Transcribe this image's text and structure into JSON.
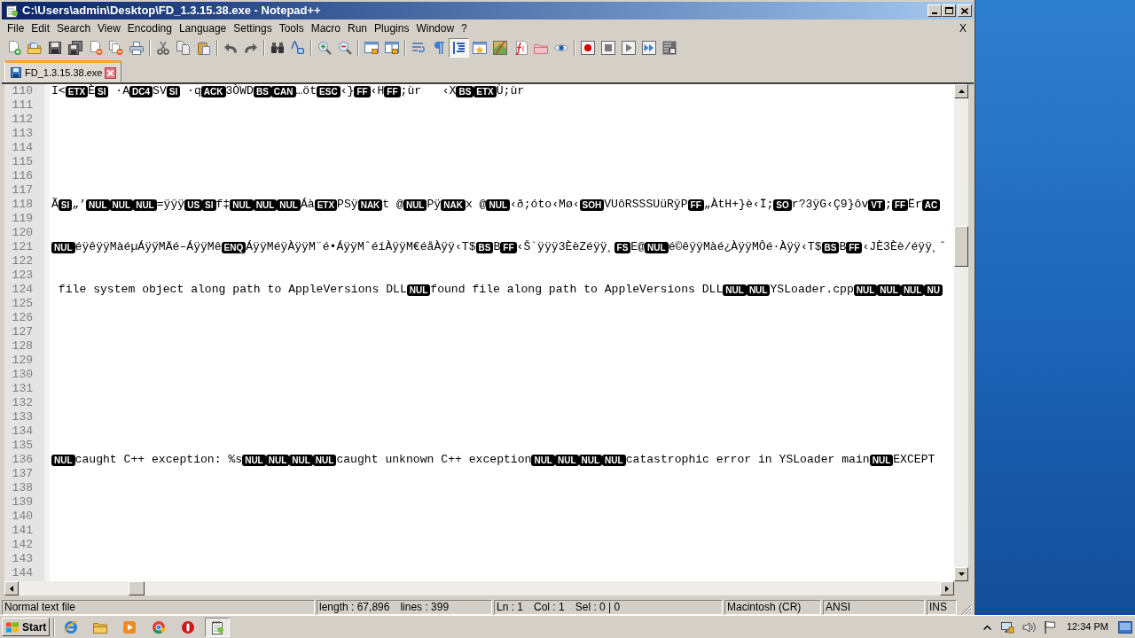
{
  "window": {
    "title": "C:\\Users\\admin\\Desktop\\FD_1.3.15.38.exe - Notepad++"
  },
  "menu": {
    "items": [
      "File",
      "Edit",
      "Search",
      "View",
      "Encoding",
      "Language",
      "Settings",
      "Tools",
      "Macro",
      "Run",
      "Plugins",
      "Window",
      "?"
    ],
    "close_label": "X"
  },
  "toolbar": [
    {
      "buttons": [
        {
          "pressed": false
        },
        {
          "pressed": false
        },
        {
          "pressed": false
        },
        {
          "pressed": false
        },
        {
          "pressed": false
        },
        {
          "pressed": false
        },
        {
          "pressed": false
        }
      ]
    },
    {
      "buttons": [
        {
          "pressed": false
        },
        {
          "pressed": false
        },
        {
          "pressed": false
        }
      ]
    },
    {
      "buttons": [
        {
          "pressed": false
        },
        {
          "pressed": false
        }
      ]
    },
    {
      "buttons": [
        {
          "pressed": false
        },
        {
          "pressed": false
        }
      ]
    },
    {
      "buttons": [
        {
          "pressed": false
        },
        {
          "pressed": false
        }
      ]
    },
    {
      "buttons": [
        {
          "pressed": false
        },
        {
          "pressed": false
        }
      ]
    },
    {
      "buttons": [
        {
          "pressed": false
        },
        {
          "pressed": false
        },
        {
          "pressed": true
        },
        {
          "pressed": false
        },
        {
          "pressed": false
        },
        {
          "pressed": false
        },
        {
          "pressed": false
        },
        {
          "pressed": false
        }
      ]
    },
    {
      "buttons": [
        {
          "pressed": false
        },
        {
          "pressed": false
        },
        {
          "pressed": false
        },
        {
          "pressed": false
        },
        {
          "pressed": false
        }
      ]
    }
  ],
  "tabs": [
    {
      "label": "FD_1.3.15.38.exe",
      "selected": true
    }
  ],
  "editor": {
    "lines": [
      {
        "number": "110",
        "segments": [
          {
            "kind": "text",
            "text": "I<"
          },
          {
            "kind": "control",
            "text": "ETX"
          },
          {
            "kind": "text",
            "text": "È"
          },
          {
            "kind": "control",
            "text": "SI"
          },
          {
            "kind": "text",
            "text": " ·A"
          },
          {
            "kind": "control",
            "text": "DC4"
          },
          {
            "kind": "text",
            "text": "SV"
          },
          {
            "kind": "control",
            "text": "SI"
          },
          {
            "kind": "text",
            "text": " ·q"
          },
          {
            "kind": "control",
            "text": "ACK"
          },
          {
            "kind": "text",
            "text": "3ÒWD"
          },
          {
            "kind": "control",
            "text": "BS"
          },
          {
            "kind": "control",
            "text": "CAN"
          },
          {
            "kind": "text",
            "text": "…öt"
          },
          {
            "kind": "control",
            "text": "ESC"
          },
          {
            "kind": "text",
            "text": "‹}"
          },
          {
            "kind": "control",
            "text": "FF"
          },
          {
            "kind": "text",
            "text": "‹H"
          },
          {
            "kind": "control",
            "text": "FF"
          },
          {
            "kind": "text",
            "text": ";ùr   ‹X"
          },
          {
            "kind": "control",
            "text": "BS"
          },
          {
            "kind": "control",
            "text": "ETX"
          },
          {
            "kind": "text",
            "text": "Ù;ùr"
          }
        ]
      },
      {
        "number": "111"
      },
      {
        "number": "112"
      },
      {
        "number": "113"
      },
      {
        "number": "114"
      },
      {
        "number": "115"
      },
      {
        "number": "116"
      },
      {
        "number": "117"
      },
      {
        "number": "118",
        "segments": [
          {
            "kind": "text",
            "text": "Ã"
          },
          {
            "kind": "control",
            "text": "SI"
          },
          {
            "kind": "text",
            "text": "„’"
          },
          {
            "kind": "control",
            "text": "NUL"
          },
          {
            "kind": "control",
            "text": "NUL"
          },
          {
            "kind": "control",
            "text": "NUL"
          },
          {
            "kind": "text",
            "text": "=ÿÿÿ"
          },
          {
            "kind": "control",
            "text": "US"
          },
          {
            "kind": "control",
            "text": "SI"
          },
          {
            "kind": "text",
            "text": "f‡"
          },
          {
            "kind": "control",
            "text": "NUL"
          },
          {
            "kind": "control",
            "text": "NUL"
          },
          {
            "kind": "control",
            "text": "NUL"
          },
          {
            "kind": "text",
            "text": "Áà"
          },
          {
            "kind": "control",
            "text": "ETX"
          },
          {
            "kind": "text",
            "text": "PSÿ"
          },
          {
            "kind": "control",
            "text": "NAK"
          },
          {
            "kind": "text",
            "text": "t @"
          },
          {
            "kind": "control",
            "text": "NUL"
          },
          {
            "kind": "text",
            "text": "Pÿ"
          },
          {
            "kind": "control",
            "text": "NAK"
          },
          {
            "kind": "text",
            "text": "x @"
          },
          {
            "kind": "control",
            "text": "NUL"
          },
          {
            "kind": "text",
            "text": "‹ð;óto‹Mø‹"
          },
          {
            "kind": "control",
            "text": "SOH"
          },
          {
            "kind": "text",
            "text": "VUôRSSSUüRÿP"
          },
          {
            "kind": "control",
            "text": "FF"
          },
          {
            "kind": "text",
            "text": "„ÀtH+}è‹Ï;"
          },
          {
            "kind": "control",
            "text": "SO"
          },
          {
            "kind": "text",
            "text": "r?3ÿG‹Ç9}ôv"
          },
          {
            "kind": "control",
            "text": "VT"
          },
          {
            "kind": "text",
            "text": ";"
          },
          {
            "kind": "control",
            "text": "FF"
          },
          {
            "kind": "text",
            "text": "Ër"
          },
          {
            "kind": "control",
            "text": "AC"
          }
        ]
      },
      {
        "number": "119"
      },
      {
        "number": "120"
      },
      {
        "number": "121",
        "segments": [
          {
            "kind": "control",
            "text": "NUL"
          },
          {
            "kind": "text",
            "text": "éÿêÿÿMàéµÁÿÿMÄé–ÁÿÿMê"
          },
          {
            "kind": "control",
            "text": "ENQ"
          },
          {
            "kind": "text",
            "text": "ÁÿÿMéÿÀÿÿM¨é•ÁÿÿMˆéíÀÿÿM€éåÀÿÿ‹T$"
          },
          {
            "kind": "control",
            "text": "BS"
          },
          {
            "kind": "text",
            "text": "B"
          },
          {
            "kind": "control",
            "text": "FF"
          },
          {
            "kind": "text",
            "text": "‹Š`ÿÿÿ3ÈèZéÿÿ¸"
          },
          {
            "kind": "control",
            "text": "FS"
          },
          {
            "kind": "text",
            "text": "E@"
          },
          {
            "kind": "control",
            "text": "NUL"
          },
          {
            "kind": "text",
            "text": "é©êÿÿMàé¿ÀÿÿMÔé·Àÿÿ‹T$"
          },
          {
            "kind": "control",
            "text": "BS"
          },
          {
            "kind": "text",
            "text": "B"
          },
          {
            "kind": "control",
            "text": "FF"
          },
          {
            "kind": "text",
            "text": "‹JÈ3Èè/éÿÿ¸ˆ"
          }
        ]
      },
      {
        "number": "122"
      },
      {
        "number": "123"
      },
      {
        "number": "124",
        "segments": [
          {
            "kind": "text",
            "text": " file system object along path to AppleVersions DLL"
          },
          {
            "kind": "control",
            "text": "NUL"
          },
          {
            "kind": "text",
            "text": "found file along path to AppleVersions DLL"
          },
          {
            "kind": "control",
            "text": "NUL"
          },
          {
            "kind": "control",
            "text": "NUL"
          },
          {
            "kind": "text",
            "text": "YSLoader.cpp"
          },
          {
            "kind": "control",
            "text": "NUL"
          },
          {
            "kind": "control",
            "text": "NUL"
          },
          {
            "kind": "control",
            "text": "NUL"
          },
          {
            "kind": "control",
            "text": "NU"
          }
        ]
      },
      {
        "number": "125"
      },
      {
        "number": "126"
      },
      {
        "number": "127"
      },
      {
        "number": "128"
      },
      {
        "number": "129"
      },
      {
        "number": "130"
      },
      {
        "number": "131"
      },
      {
        "number": "132"
      },
      {
        "number": "133"
      },
      {
        "number": "134"
      },
      {
        "number": "135"
      },
      {
        "number": "136",
        "segments": [
          {
            "kind": "control",
            "text": "NUL"
          },
          {
            "kind": "text",
            "text": "caught C++ exception: %s"
          },
          {
            "kind": "control",
            "text": "NUL"
          },
          {
            "kind": "control",
            "text": "NUL"
          },
          {
            "kind": "control",
            "text": "NUL"
          },
          {
            "kind": "control",
            "text": "NUL"
          },
          {
            "kind": "text",
            "text": "caught unknown C++ exception"
          },
          {
            "kind": "control",
            "text": "NUL"
          },
          {
            "kind": "control",
            "text": "NUL"
          },
          {
            "kind": "control",
            "text": "NUL"
          },
          {
            "kind": "control",
            "text": "NUL"
          },
          {
            "kind": "text",
            "text": "catastrophic error in YSLoader main"
          },
          {
            "kind": "control",
            "text": "NUL"
          },
          {
            "kind": "text",
            "text": "EXCEPT"
          }
        ]
      },
      {
        "number": "137"
      },
      {
        "number": "138"
      },
      {
        "number": "139"
      },
      {
        "number": "140"
      },
      {
        "number": "141"
      },
      {
        "number": "142"
      },
      {
        "number": "143"
      },
      {
        "number": "144"
      }
    ]
  },
  "status_bar": {
    "sections": [
      [
        "Normal text file"
      ],
      [
        "length : 67,896",
        "lines : 399"
      ],
      [
        "Ln : 1",
        "Col : 1",
        "Sel : 0 | 0"
      ],
      [
        "Macintosh (CR)"
      ],
      [
        "ANSI"
      ],
      [
        "INS"
      ]
    ]
  },
  "taskbar": {
    "start_label": "Start",
    "apps": [
      {
        "selected": false
      },
      {
        "selected": false
      },
      {
        "selected": false
      },
      {
        "selected": false
      },
      {
        "selected": false
      },
      {
        "selected": true
      }
    ],
    "clock": "12:34 PM"
  }
}
